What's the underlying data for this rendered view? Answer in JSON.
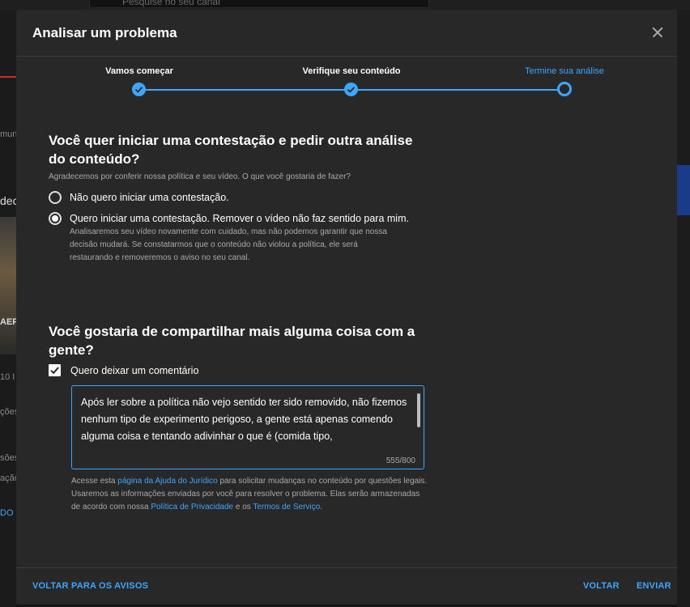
{
  "background": {
    "search_placeholder": "Pesquise no seu canal",
    "side_texts": [
      "muni",
      "dec",
      "AEF",
      "10 I",
      "ções",
      "sões",
      "ação",
      "DO V"
    ]
  },
  "dialog": {
    "title": "Analisar um problema",
    "steps": [
      {
        "label": "Vamos começar",
        "state": "done"
      },
      {
        "label": "Verifique seu conteúdo",
        "state": "done"
      },
      {
        "label": "Termine sua análise",
        "state": "current"
      }
    ],
    "question1": "Você quer iniciar uma contestação e pedir outra análise do conteúdo?",
    "question1_sub": "Agradecemos por conferir nossa política e seu vídeo. O que você gostaria de fazer?",
    "options": [
      {
        "label": "Não quero iniciar uma contestação.",
        "checked": false
      },
      {
        "label": "Quero iniciar uma contestação. Remover o vídeo não faz sentido para mim.",
        "checked": true,
        "description": "Analisaremos seu vídeo novamente com cuidado, mas não podemos garantir que nossa decisão mudará. Se constatarmos que o conteúdo não violou a política, ele será restaurando e removeremos o aviso no seu canal."
      }
    ],
    "question2": "Você gostaria de compartilhar mais alguma coisa com a gente?",
    "comment_checkbox": {
      "label": "Quero deixar um comentário",
      "checked": true
    },
    "comment": {
      "value": "Após ler sobre a política não vejo sentido ter sido removido, não fizemos nenhum tipo de experimento perigoso, a gente está apenas comendo alguma coisa e tentando adivinhar o que é (comida tipo,",
      "count": "555/800"
    },
    "legal": {
      "p1": "Acesse esta ",
      "link1": "página da Ajuda do Jurídico",
      "p2": " para solicitar mudanças no conteúdo por questões legais. Usaremos as informações enviadas por você para resolver o problema. Elas serão armazenadas de acordo com nossa ",
      "link2": "Política de Privacidade",
      "p3": " e os ",
      "link3": "Termos de Serviço",
      "p4": "."
    },
    "footer": {
      "back_to_warnings": "VOLTAR PARA OS AVISOS",
      "back": "VOLTAR",
      "send": "ENVIAR"
    }
  },
  "colors": {
    "accent": "#3ea6ff",
    "dialog_bg": "#282828"
  }
}
